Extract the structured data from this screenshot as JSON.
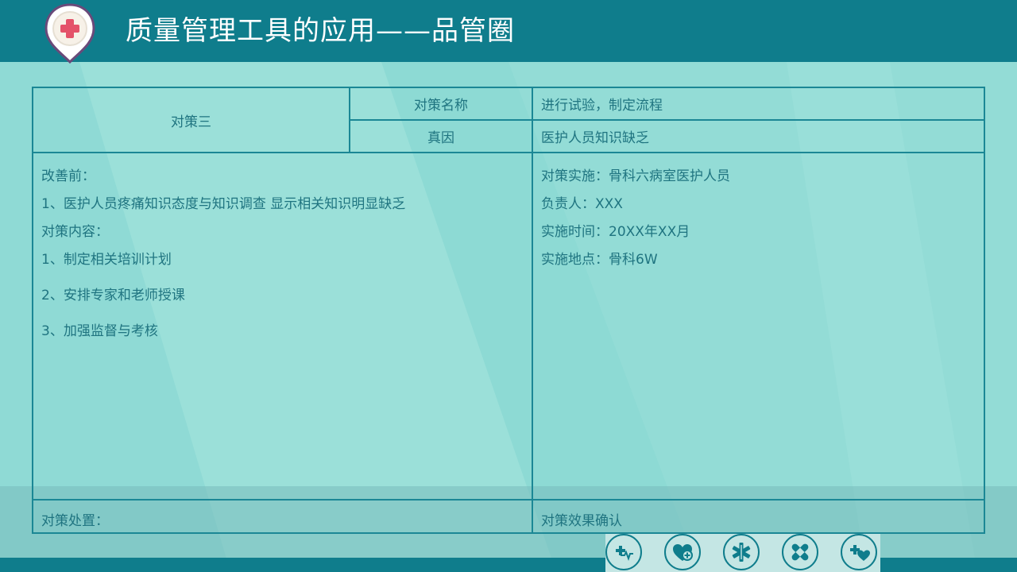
{
  "header": {
    "title": "质量管理工具的应用——品管圈"
  },
  "colors": {
    "header_bg": "#0f7d8c",
    "page_bg": "#93dcd6",
    "grid_line": "#1b8795",
    "text": "#1f7480",
    "logo_cross": "#e4526a"
  },
  "table": {
    "measure_no": "对策三",
    "measure_name_label": "对策名称",
    "measure_name_value": "进行试验，制定流程",
    "root_cause_label": "真因",
    "root_cause_value": "医护人员知识缺乏",
    "before": {
      "heading": "改善前：",
      "lines": [
        "1、医护人员疼痛知识态度与知识调查 显示相关知识明显缺乏"
      ]
    },
    "content": {
      "heading": "对策内容：",
      "items": [
        "1、制定相关培训计划",
        "2、安排专家和老师授课",
        "3、加强监督与考核"
      ]
    },
    "implementation": {
      "lines": [
        "对策实施：骨科六病室医护人员",
        "负责人：XXX",
        "实施时间：20XX年XX月",
        "实施地点：骨科6W"
      ]
    },
    "disposal_label": "对策处置：",
    "effect_label": "对策效果确认"
  },
  "footer_icons": [
    "medical-pulse-icon",
    "heart-plus-icon",
    "star-of-life-icon",
    "bandage-icon",
    "medical-heart-icon"
  ]
}
